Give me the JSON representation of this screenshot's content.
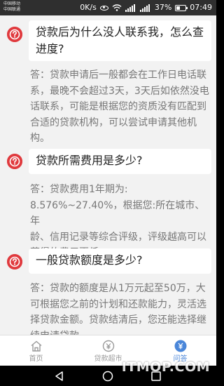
{
  "status_bar": {
    "carrier_1": "中国移动",
    "carrier_2": "中国联通",
    "network_speed": "0K/s",
    "battery": "37%",
    "time": "07:49"
  },
  "faq": [
    {
      "question_lines": [
        "贷款后为什么没人联系我，怎么查",
        "进度?"
      ],
      "answer_lines": [
        "答：贷款申请后一般都会在工作日电话联",
        "系，最晚不会超过3天，3天后如依然没电",
        "话联系，可能是根据您的资质没有匹配到",
        "合适的贷款机构，可以尝试申请其他机",
        "构。"
      ]
    },
    {
      "question_lines": [
        "贷款所需费用是多少?"
      ],
      "answer_lines": [
        "答：贷款费用1年期为:",
        "8.576%~27.40%，根据您:所在城市、年",
        "龄、信用记录等综合评级，评级越高可以",
        "获得的费用更低。"
      ]
    },
    {
      "question_lines": [
        "一般贷款额度是多少?"
      ],
      "answer_lines": [
        "答：贷款的额度是从1万元起至50万，大",
        "可根据您之前的计划和还款能力，灵活选",
        "择贷款金额。贷款结清后，您还能选择继",
        "续申请贷款。"
      ]
    }
  ],
  "tabs": [
    {
      "label": "首页",
      "icon": "home-icon",
      "active": false
    },
    {
      "label": "贷款超市",
      "icon": "loan-market-icon",
      "active": false
    },
    {
      "label": "问答",
      "icon": "qa-icon",
      "active": true
    }
  ],
  "watermark": "ITMOP.COM",
  "colors": {
    "accent": "#4a86d9",
    "question_icon": "#e03a3e",
    "status_bar_bg": "#2f2f2f",
    "page_bg": "#f2f2f2"
  }
}
